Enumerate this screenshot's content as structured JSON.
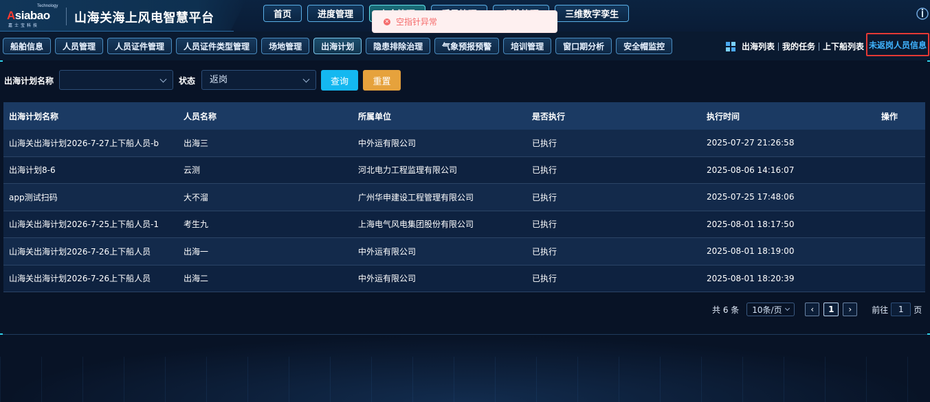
{
  "header": {
    "logo": {
      "tech": "Technology",
      "main_a": "A",
      "main_rest": "siabao",
      "sub": "嘉士宝科技"
    },
    "title": "山海关海上风电智慧平台",
    "nav": [
      {
        "label": "首页",
        "active": false
      },
      {
        "label": "进度管理",
        "active": false
      },
      {
        "label": "安全管理",
        "active": true
      },
      {
        "label": "质量管理",
        "active": false
      },
      {
        "label": "运维管理",
        "active": false
      },
      {
        "label": "三维数字孪生",
        "active": false
      }
    ]
  },
  "toast": {
    "icon": "error-icon",
    "message": "空指针异常"
  },
  "subnav": [
    {
      "label": "船舶信息"
    },
    {
      "label": "人员管理"
    },
    {
      "label": "人员证件管理"
    },
    {
      "label": "人员证件类型管理"
    },
    {
      "label": "场地管理"
    },
    {
      "label": "出海计划",
      "active": true
    },
    {
      "label": "隐患排除治理"
    },
    {
      "label": "气象预报预警"
    },
    {
      "label": "培训管理"
    },
    {
      "label": "窗口期分析"
    },
    {
      "label": "安全帽监控"
    }
  ],
  "right_links": {
    "icon": "grid-icon",
    "items": [
      "出海列表",
      "我的任务",
      "上下船列表"
    ],
    "highlighted": "未返岗人员信息"
  },
  "filter": {
    "plan_label": "出海计划名称",
    "plan_value": "",
    "status_label": "状态",
    "status_value": "返岗",
    "query_label": "查询",
    "reset_label": "重置"
  },
  "table": {
    "columns": [
      "出海计划名称",
      "人员名称",
      "所属单位",
      "是否执行",
      "执行时间",
      "操作"
    ],
    "rows": [
      [
        "山海关出海计划2026-7-27上下船人员-b",
        "出海三",
        "中外运有限公司",
        "已执行",
        "2025-07-27 21:26:58",
        ""
      ],
      [
        "出海计划8-6",
        "云测",
        "河北电力工程监理有限公司",
        "已执行",
        "2025-08-06 14:16:07",
        ""
      ],
      [
        "app测试扫码",
        "大不溜",
        "广州华申建设工程管理有限公司",
        "已执行",
        "2025-07-25 17:48:06",
        ""
      ],
      [
        "山海关出海计划2026-7-25上下船人员-1",
        "考生九",
        "上海电气风电集团股份有限公司",
        "已执行",
        "2025-08-01 18:17:50",
        ""
      ],
      [
        "山海关出海计划2026-7-26上下船人员",
        "出海一",
        "中外运有限公司",
        "已执行",
        "2025-08-01 18:19:00",
        ""
      ],
      [
        "山海关出海计划2026-7-26上下船人员",
        "出海二",
        "中外运有限公司",
        "已执行",
        "2025-08-01 18:20:39",
        ""
      ]
    ]
  },
  "pagination": {
    "total_text": "共 6 条",
    "page_size": "10条/页",
    "prev": "‹",
    "current": "1",
    "next": "›",
    "goto_label": "前往",
    "goto_value": "1",
    "page_suffix": "页"
  }
}
